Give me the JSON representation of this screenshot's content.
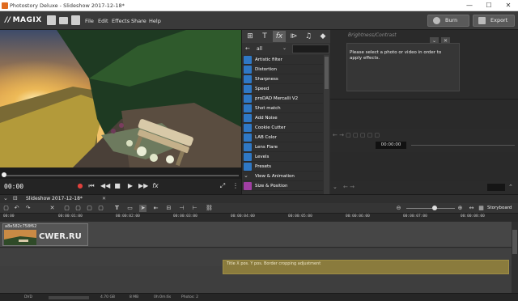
{
  "window": {
    "title": "Photostory Deluxe - Slideshow 2017-12-18*",
    "minimize": "—",
    "maximize": "☐",
    "close": "✕"
  },
  "menubar": {
    "logo": "MAGIX",
    "items": [
      "File",
      "Edit",
      "Effects",
      "Share",
      "Help"
    ],
    "burn_label": "Burn",
    "export_label": "Export"
  },
  "player": {
    "timecode": "00:00",
    "fx": "fx"
  },
  "effects": {
    "filter": "all",
    "items": [
      "Artistic filter",
      "Distortion",
      "Sharpness",
      "Speed",
      "proDAD Mercalli V2",
      "Shot match",
      "Add Noise",
      "Cookie Cutter",
      "LAB Color",
      "Lens Flare",
      "Levels",
      "Presets",
      "View & Animation",
      "Size & Position"
    ]
  },
  "right_panel": {
    "title": "Brightness/Contrast",
    "message": "Please select a photo or video in order to apply effects.",
    "timecode": "00:00:00"
  },
  "tab": {
    "name": "Slideshow 2017-12-18*",
    "close": "✕"
  },
  "toolbar": {
    "storyboard_label": "Storyboard"
  },
  "ruler": [
    "00:00",
    "00:00:01:00",
    "00:00:02:00",
    "00:00:03:00",
    "00:00:04:00",
    "00:00:05:00",
    "00:00:06:00",
    "00:00:07:00",
    "00:00:08:00"
  ],
  "timeline": {
    "clip_label": "a8e582c758f62",
    "clip_overlay": "CWER.RU",
    "fx_label": "Title  X pos.  Y pos.  Border cropping adjustment"
  },
  "status": {
    "drive": "DVD",
    "size": "4.70 GB",
    "used": "8 MB",
    "duration": "0h:0m:6s",
    "photos": "Photos: 2"
  },
  "colors": {
    "accent": "#e06b1f",
    "effect_icon": "#2f78c5",
    "fx_bar": "#8a7b3d"
  }
}
